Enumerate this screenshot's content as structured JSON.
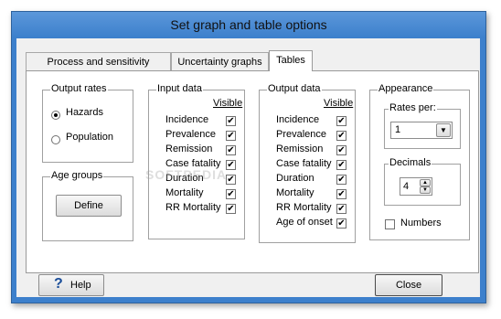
{
  "window": {
    "title": "Set graph and table options"
  },
  "tabs": [
    {
      "label": "Process and sensitivity graphs"
    },
    {
      "label": "Uncertainty graphs"
    },
    {
      "label": "Tables"
    }
  ],
  "output_rates": {
    "label": "Output rates",
    "options": [
      "Hazards",
      "Population"
    ],
    "selected": "Hazards"
  },
  "age_groups": {
    "label": "Age groups",
    "define_label": "Define"
  },
  "input_data": {
    "label": "Input data",
    "visible_header": "Visible",
    "rows": [
      {
        "label": "Incidence",
        "checked": true
      },
      {
        "label": "Prevalence",
        "checked": true
      },
      {
        "label": "Remission",
        "checked": true
      },
      {
        "label": "Case fatality",
        "checked": true
      },
      {
        "label": "Duration",
        "checked": true
      },
      {
        "label": "Mortality",
        "checked": true
      },
      {
        "label": "RR Mortality",
        "checked": true
      }
    ]
  },
  "output_data": {
    "label": "Output data",
    "visible_header": "Visible",
    "rows": [
      {
        "label": "Incidence",
        "checked": true
      },
      {
        "label": "Prevalence",
        "checked": true
      },
      {
        "label": "Remission",
        "checked": true
      },
      {
        "label": "Case fatality",
        "checked": true
      },
      {
        "label": "Duration",
        "checked": true
      },
      {
        "label": "Mortality",
        "checked": true
      },
      {
        "label": "RR Mortality",
        "checked": true
      },
      {
        "label": "Age of onset",
        "checked": true
      }
    ]
  },
  "appearance": {
    "label": "Appearance",
    "rates_per_label": "Rates per:",
    "rates_per_value": "1",
    "decimals_label": "Decimals",
    "decimals_value": "4",
    "numbers_label": "Numbers",
    "numbers_checked": false
  },
  "footer": {
    "help_label": "Help",
    "close_label": "Close"
  },
  "watermark": "SOFTPEDIA",
  "colors": {
    "titlebar": "#3d80cc",
    "client": "#f0f0f0"
  }
}
